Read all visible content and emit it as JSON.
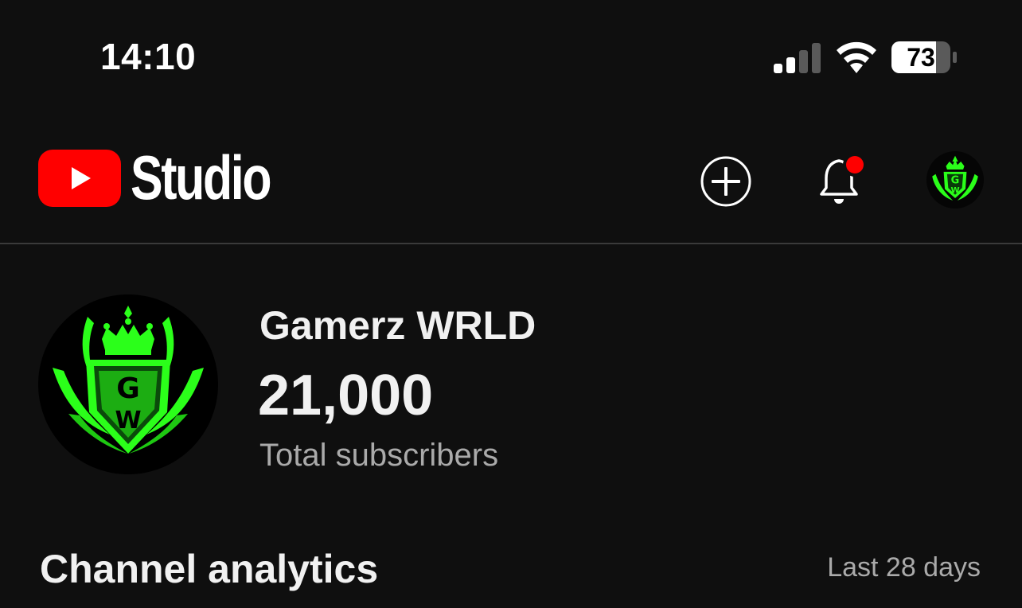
{
  "status_bar": {
    "time": "14:10",
    "battery_percent": "73",
    "signal_bars_active": 2,
    "signal_bars_total": 4
  },
  "header": {
    "logo_icon": "youtube-play-icon",
    "app_name": "Studio",
    "create_icon": "plus-circle-icon",
    "notifications_icon": "bell-icon",
    "notification_dot_color": "#ff0000",
    "brand_color": "#ff0000"
  },
  "channel": {
    "name": "Gamerz WRLD",
    "subscriber_count": "21,000",
    "subscriber_label": "Total subscribers",
    "avatar_accent_color": "#2bff1a"
  },
  "analytics": {
    "title": "Channel analytics",
    "range": "Last 28 days"
  }
}
